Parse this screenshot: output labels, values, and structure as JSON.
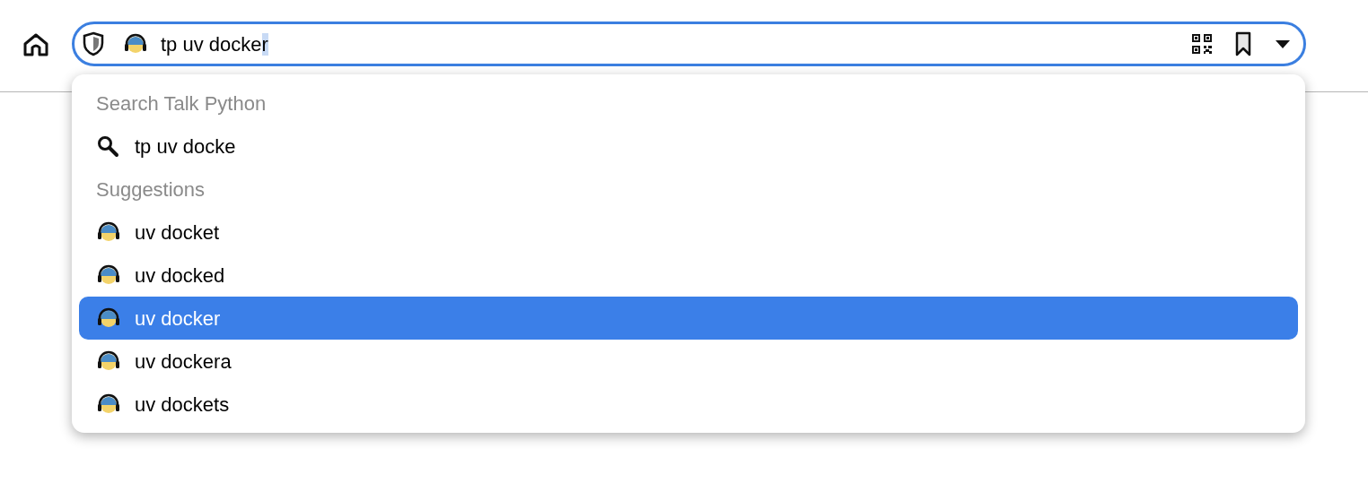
{
  "address_bar": {
    "value": "tp uv docke",
    "completion": "r"
  },
  "dropdown": {
    "search_heading": "Search Talk Python",
    "search_query": "tp uv docke",
    "suggestions_heading": "Suggestions",
    "suggestions": [
      {
        "label": "uv docket",
        "selected": false
      },
      {
        "label": "uv docked",
        "selected": false
      },
      {
        "label": "uv docker",
        "selected": true
      },
      {
        "label": "uv dockera",
        "selected": false
      },
      {
        "label": "uv dockets",
        "selected": false
      }
    ]
  }
}
